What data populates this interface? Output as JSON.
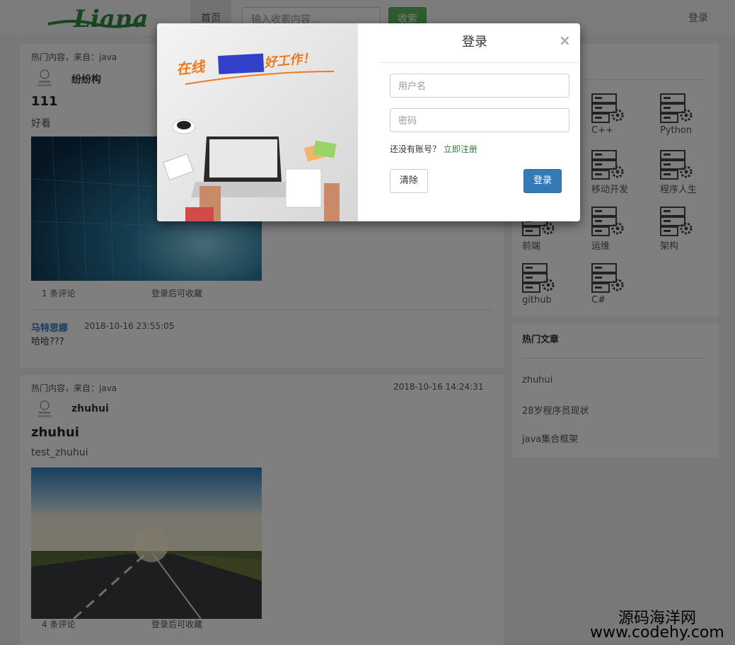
{
  "nav": {
    "logo_text": "Liana",
    "home_label": "首页",
    "search_placeholder": "输入收索内容...",
    "search_button": "收索",
    "login_link": "登录"
  },
  "posts": [
    {
      "meta": "热门内容，来自：java",
      "date": "",
      "author": "纷纷构",
      "title": "111",
      "desc": "好看",
      "comments": "1 条评论",
      "favorite": "登录后可收藏",
      "comment": {
        "user": "马特思娜",
        "time": "2018-10-16 23:55:05",
        "text": "哈哈???"
      }
    },
    {
      "meta": "热门内容，来自：java",
      "date": "2018-10-16 14:24:31",
      "author": "zhuhui",
      "title": "zhuhui",
      "desc": "test_zhuhui",
      "comments": "4 条评论",
      "favorite": "登录后可收藏"
    }
  ],
  "categories": [
    {
      "label": "",
      "icon": "server-gear-icon"
    },
    {
      "label": "C++",
      "icon": "server-gear-icon"
    },
    {
      "label": "Python",
      "icon": "server-gear-icon"
    },
    {
      "label": "",
      "icon": "server-gear-icon"
    },
    {
      "label": "移动开发",
      "icon": "server-gear-icon"
    },
    {
      "label": "程序人生",
      "icon": "server-gear-icon"
    },
    {
      "label": "前端",
      "icon": "server-gear-icon"
    },
    {
      "label": "运维",
      "icon": "server-gear-icon"
    },
    {
      "label": "架构",
      "icon": "server-gear-icon"
    },
    {
      "label": "github",
      "icon": "server-gear-icon"
    },
    {
      "label": "C#",
      "icon": "server-gear-icon"
    }
  ],
  "hot": {
    "title": "热门文章",
    "items": [
      "zhuhui",
      "28岁程序员现状",
      "java集合框架"
    ]
  },
  "modal": {
    "title": "登录",
    "close": "×",
    "username_placeholder": "用户名",
    "password_placeholder": "密码",
    "register_prompt": "还没有账号？",
    "register_link": "立即注册",
    "clear_button": "清除",
    "login_button": "登录",
    "banner_left": "在线",
    "banner_right": "好工作！"
  },
  "watermark": {
    "line1": "源码海洋网",
    "line2": "www.codehy.com"
  }
}
